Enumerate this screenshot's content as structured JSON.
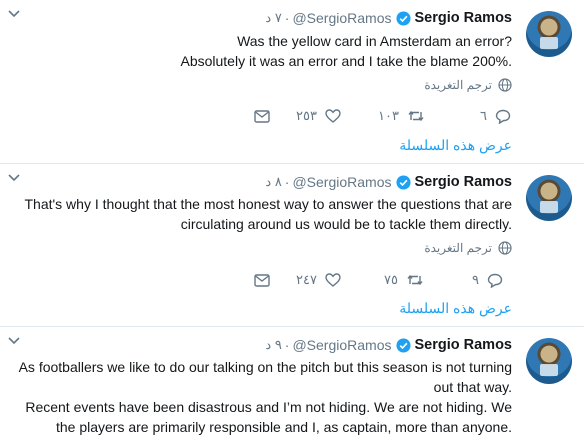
{
  "tweets": [
    {
      "author_name": "Sergio Ramos",
      "handle": "@SergioRamos",
      "time": "٧ د",
      "lines": [
        "Was the yellow card in Amsterdam an error?",
        "Absolutely it was an error and I take the blame 200%."
      ],
      "translate": "ترجم التغريدة",
      "replies": "٦",
      "retweets": "١٠٣",
      "likes": "٢٥٣",
      "show_thread": "عرض هذه السلسلة"
    },
    {
      "author_name": "Sergio Ramos",
      "handle": "@SergioRamos",
      "time": "٨ د",
      "lines": [
        "That's why I thought that the most honest way to answer the questions that are",
        "circulating around us would be to tackle them directly."
      ],
      "translate": "ترجم التغريدة",
      "replies": "٩",
      "retweets": "٧٥",
      "likes": "٢٤٧",
      "show_thread": "عرض هذه السلسلة"
    },
    {
      "author_name": "Sergio Ramos",
      "handle": "@SergioRamos",
      "time": "٩ د",
      "lines": [
        "As footballers we like to do our talking on the pitch but this season is not turning",
        "out that way.",
        "Recent events have been disastrous and I’m not hiding. We are not hiding. We",
        "the players are primarily responsible and I, as captain, more than anyone."
      ]
    }
  ],
  "colors": {
    "link": "#1da1f2",
    "muted": "#657786",
    "verified": "#1da1f2",
    "divider": "#e1e8ed"
  },
  "icons": {
    "verified": "verified-badge-icon",
    "chevron": "chevron-down-icon",
    "reply": "reply-icon",
    "retweet": "retweet-icon",
    "like": "heart-icon",
    "dm": "envelope-icon",
    "globe": "globe-icon"
  }
}
